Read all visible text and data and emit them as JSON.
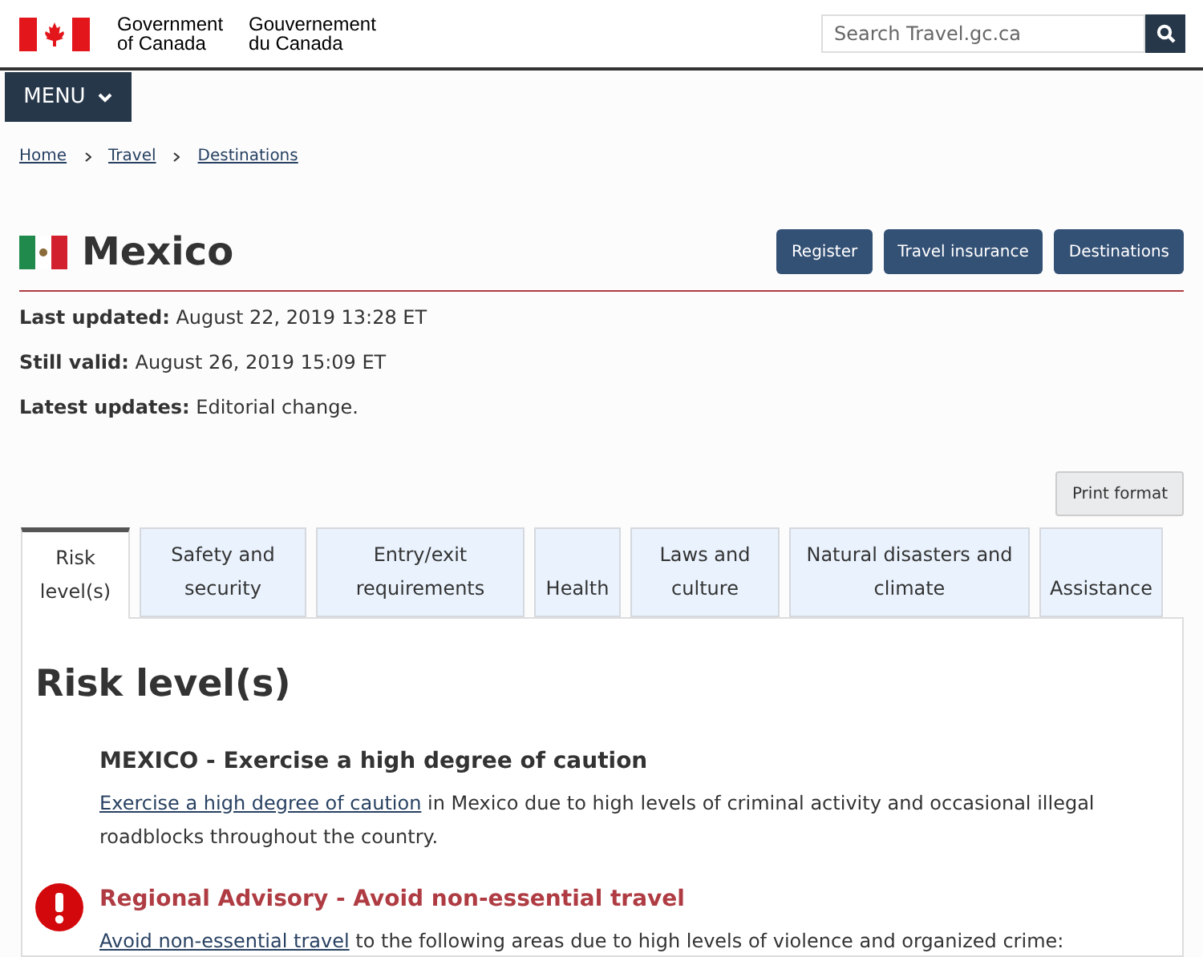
{
  "header": {
    "wordmark_en": [
      "Government",
      "of Canada"
    ],
    "wordmark_fr": [
      "Gouvernement",
      "du Canada"
    ],
    "search": {
      "placeholder": "Search Travel.gc.ca"
    }
  },
  "menu": {
    "label": "MENU"
  },
  "breadcrumb": [
    "Home",
    "Travel",
    "Destinations"
  ],
  "page": {
    "title": "Mexico",
    "buttons": [
      "Register",
      "Travel insurance",
      "Destinations"
    ],
    "meta": [
      "**Last updated:** August 22, 2019 13:28 ET",
      "**Still valid:** August 26, 2019 15:09 ET",
      "**Latest updates:** Editorial change."
    ],
    "print_button": "Print format"
  },
  "tabs": [
    {
      "label": "Risk level(s)",
      "selected": true
    },
    {
      "label": "Safety and security",
      "selected": false
    },
    {
      "label": "Entry/exit requirements",
      "selected": false
    },
    {
      "label": "Health",
      "selected": false
    },
    {
      "label": "Laws and culture",
      "selected": false
    },
    {
      "label": "Natural disasters and climate",
      "selected": false
    },
    {
      "label": "Assistance",
      "selected": false
    }
  ],
  "panel": {
    "heading": "Risk level(s)",
    "advisories": [
      {
        "kind": "national",
        "title": "MEXICO - Exercise a high degree of caution",
        "link": "Exercise a high degree of caution",
        "text": " in Mexico due to high levels of criminal activity and occasional illegal roadblocks throughout the country."
      },
      {
        "kind": "regional",
        "title": "Regional Advisory - Avoid non-essential travel",
        "link": "Avoid non-essential travel",
        "text": " to the following areas due to high levels of violence and organized crime:"
      }
    ]
  }
}
